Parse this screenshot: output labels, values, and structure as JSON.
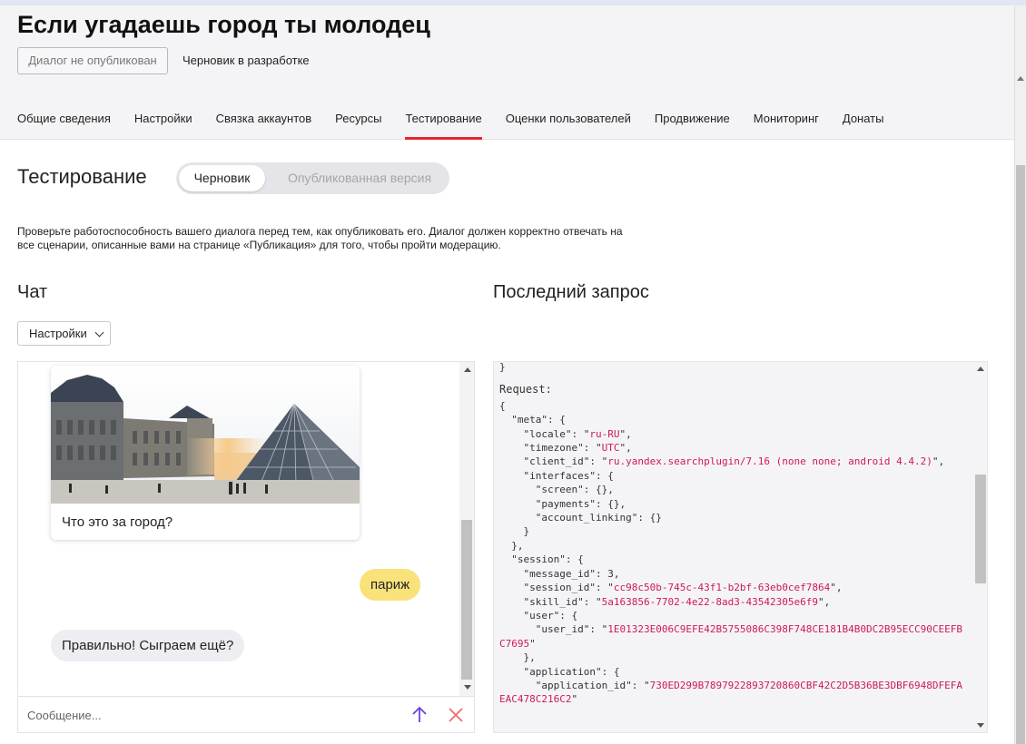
{
  "header": {
    "title": "Если угадаешь город ты молодец",
    "status_button": "Диалог не опубликован",
    "draft_status": "Черновик в разработке",
    "tabs": [
      {
        "label": "Общие сведения"
      },
      {
        "label": "Настройки"
      },
      {
        "label": "Связка аккаунтов"
      },
      {
        "label": "Ресурсы"
      },
      {
        "label": "Тестирование",
        "active": true
      },
      {
        "label": "Оценки пользователей"
      },
      {
        "label": "Продвижение"
      },
      {
        "label": "Мониторинг"
      },
      {
        "label": "Донаты"
      }
    ]
  },
  "testing": {
    "title": "Тестирование",
    "version_switch": {
      "draft": "Черновик",
      "published": "Опубликованная версия",
      "selected": "Черновик"
    },
    "description": "Проверьте работоспособность вашего диалога перед тем, как опубликовать его. Диалог должен корректно отвечать на все сценарии, описанные вами на странице «Публикация» для того, чтобы пройти модерацию."
  },
  "chat": {
    "title": "Чат",
    "settings_button": "Настройки",
    "messages": [
      {
        "from": "bot",
        "type": "card",
        "image": "louvre-pyramid-photo",
        "text": "Что это за город?"
      },
      {
        "from": "user",
        "text": "париж"
      },
      {
        "from": "bot",
        "text": "Правильно! Сыграем ещё?"
      }
    ],
    "input": {
      "placeholder": "Сообщение...",
      "value": ""
    },
    "icons": {
      "send": "arrow-up-icon",
      "clear": "close-icon"
    }
  },
  "last_request": {
    "title": "Последний запрос",
    "closing_brace": "}",
    "label": "Request:",
    "meta": {
      "locale": "ru-RU",
      "timezone": "UTC",
      "client_id": "ru.yandex.searchplugin/7.16 (none none; android 4.4.2)"
    },
    "session": {
      "message_id": "3",
      "session_id": "cc98c50b-745c-43f1-b2bf-63eb0cef7864",
      "skill_id": "5a163856-7702-4e22-8ad3-43542305e6f9",
      "user_id": "1E01323E006C9EFE42B5755086C398F748CE181B4B0DC2B95ECC90CEEFBC7695",
      "application_id": "730ED299B7897922893720860CBF42C2D5B36BE3DBF6948DFEFAEAC478C216C2"
    }
  },
  "colors": {
    "tab_active_underline": "#e8262d",
    "user_bubble": "#f9e27a",
    "bot_bubble": "#eeeef2",
    "send_icon": "#6b44e0",
    "clear_icon": "#f06a6a",
    "json_string": "#d0185a"
  }
}
